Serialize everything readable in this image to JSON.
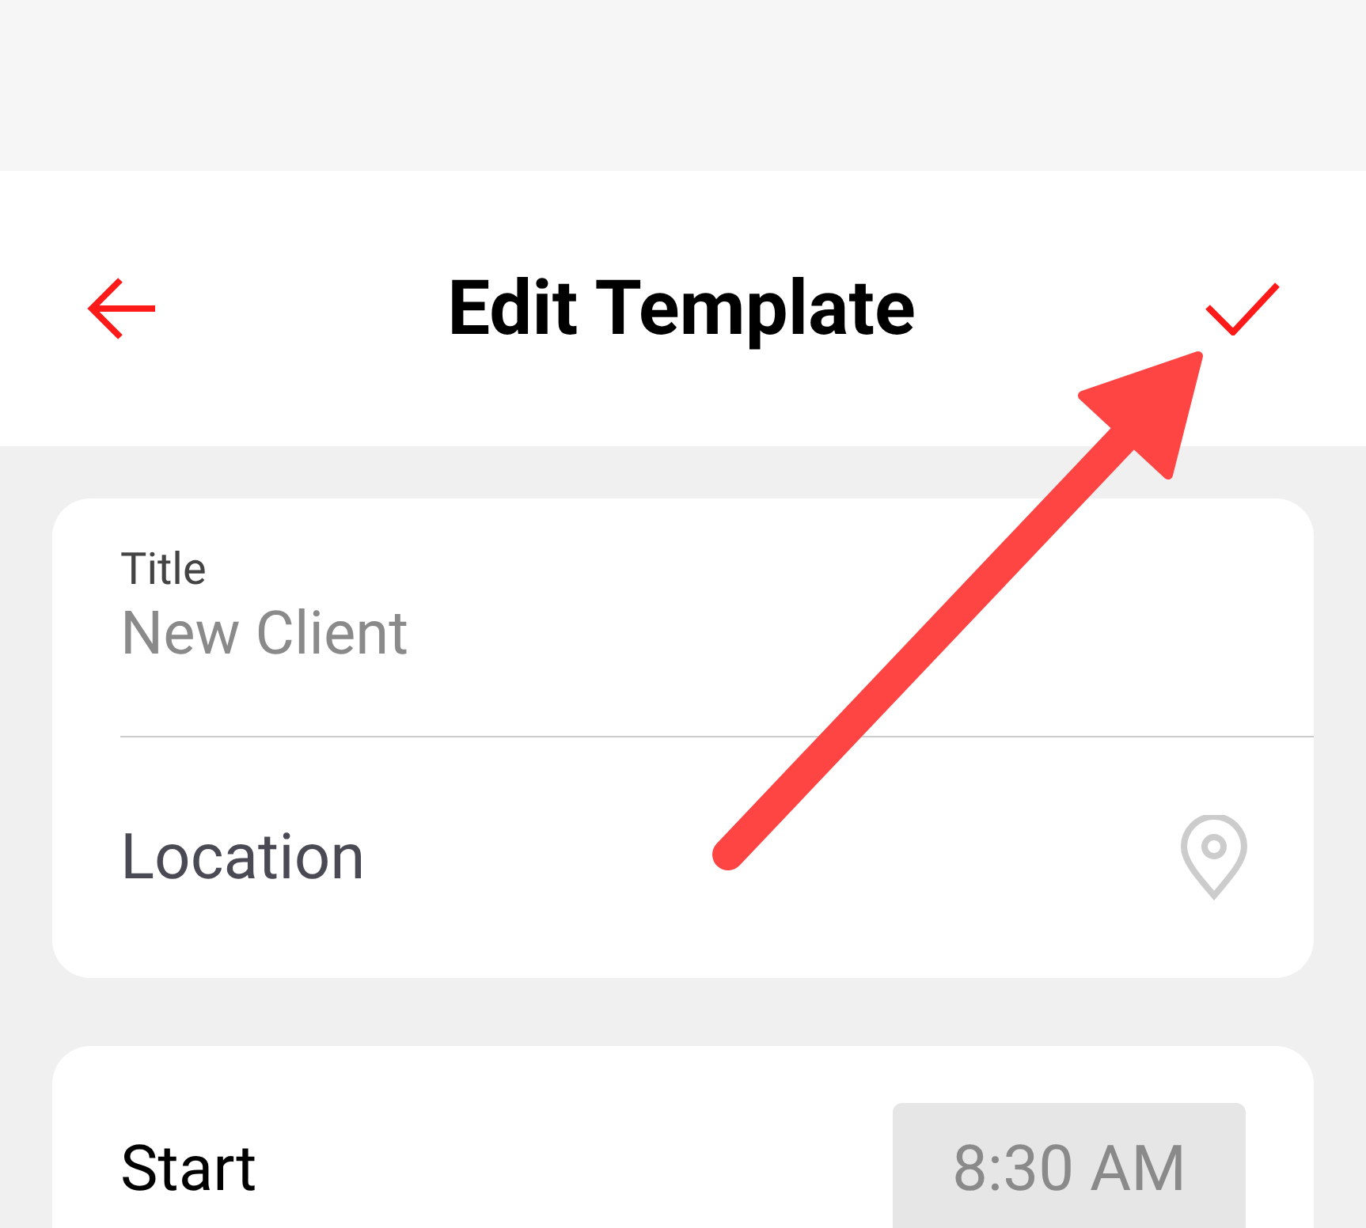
{
  "header": {
    "title": "Edit Template"
  },
  "title_field": {
    "label": "Title",
    "placeholder": "New Client"
  },
  "location_field": {
    "placeholder": "Location"
  },
  "start": {
    "label": "Start",
    "value": "8:30 AM"
  }
}
